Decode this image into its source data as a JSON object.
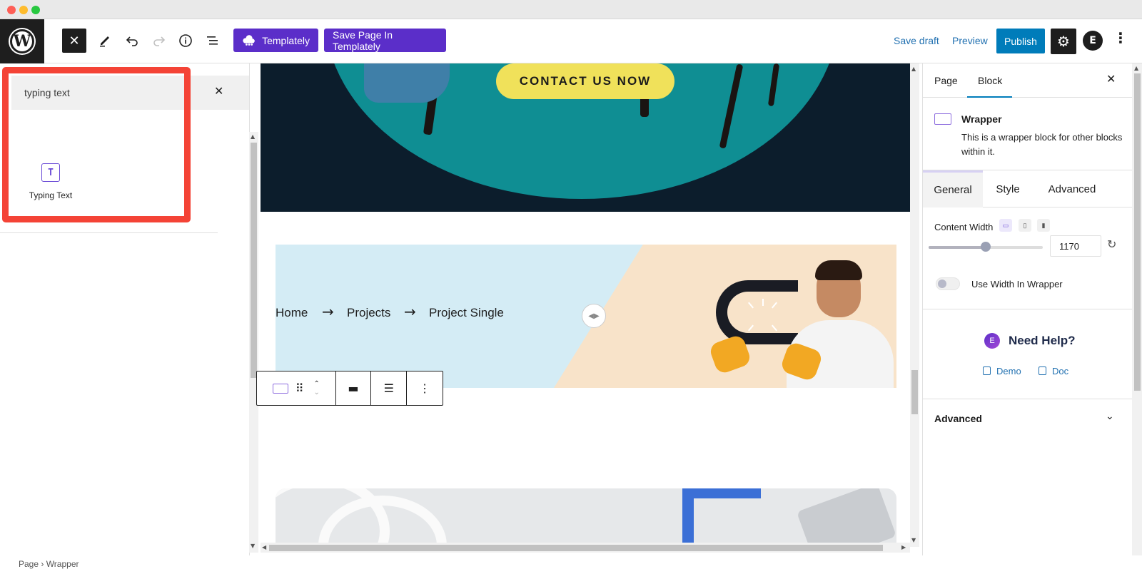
{
  "toolbar": {
    "templately_label": "Templately",
    "save_templately_label": "Save Page In Templately",
    "save_draft_label": "Save draft",
    "preview_label": "Preview",
    "publish_label": "Publish"
  },
  "inserter": {
    "search_value": "typing text",
    "results": [
      {
        "label": "Typing Text",
        "icon": "typing-text-icon"
      }
    ],
    "highlight_color": "#f44336"
  },
  "footer": {
    "breadcrumb": "Page  ›  Wrapper"
  },
  "canvas": {
    "cta_label": "CONTACT US NOW",
    "breadcrumb": [
      "Home",
      "Projects",
      "Project Single"
    ]
  },
  "sidebar": {
    "tabs": [
      "Page",
      "Block"
    ],
    "active_tab": "Block",
    "block": {
      "name": "Wrapper",
      "description": "This is a wrapper block for other blocks within it."
    },
    "subtabs": [
      "General",
      "Style",
      "Advanced"
    ],
    "active_subtab": "General",
    "content_width_label": "Content Width",
    "content_width_value": "1170",
    "use_width_label": "Use Width In Wrapper",
    "help_title": "Need Help?",
    "help_links": [
      "Demo",
      "Doc"
    ],
    "advanced_label": "Advanced"
  },
  "colors": {
    "accent_purple": "#5b2ec9",
    "publish_blue": "#007cba",
    "cta_yellow": "#f0e15a"
  }
}
